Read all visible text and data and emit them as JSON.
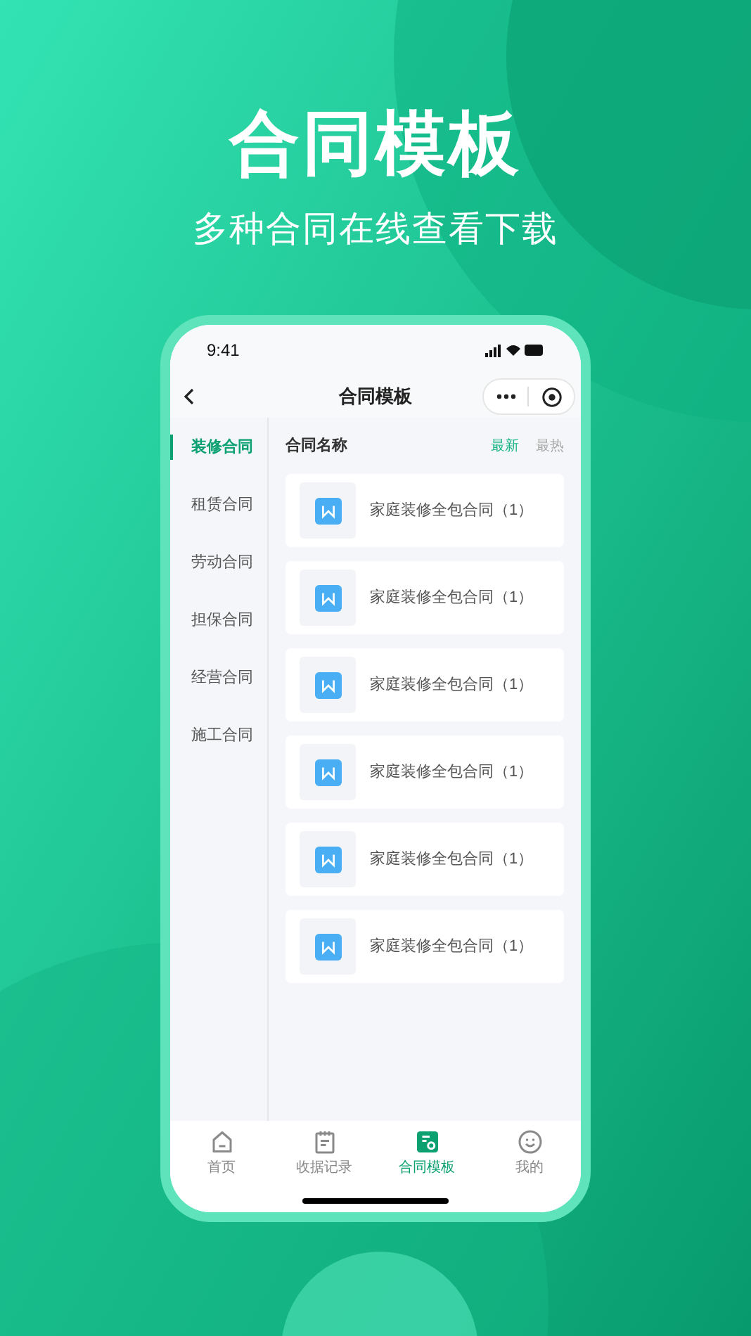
{
  "headline": "合同模板",
  "subheadline": "多种合同在线查看下载",
  "status_bar": {
    "time": "9:41"
  },
  "nav": {
    "title": "合同模板"
  },
  "categories": [
    {
      "label": "装修合同",
      "selected": true
    },
    {
      "label": "租赁合同",
      "selected": false
    },
    {
      "label": "劳动合同",
      "selected": false
    },
    {
      "label": "担保合同",
      "selected": false
    },
    {
      "label": "经营合同",
      "selected": false
    },
    {
      "label": "施工合同",
      "selected": false
    }
  ],
  "list_header": {
    "title": "合同名称",
    "sorts": [
      {
        "label": "最新",
        "selected": true
      },
      {
        "label": "最热",
        "selected": false
      }
    ]
  },
  "contracts": [
    {
      "name": "家庭装修全包合同（1）"
    },
    {
      "name": "家庭装修全包合同（1）"
    },
    {
      "name": "家庭装修全包合同（1）"
    },
    {
      "name": "家庭装修全包合同（1）"
    },
    {
      "name": "家庭装修全包合同（1）"
    },
    {
      "name": "家庭装修全包合同（1）"
    }
  ],
  "tab_bar": [
    {
      "label": "首页",
      "kind": "home",
      "selected": false
    },
    {
      "label": "收据记录",
      "kind": "notes",
      "selected": false
    },
    {
      "label": "合同模板",
      "kind": "template",
      "selected": true
    },
    {
      "label": "我的",
      "kind": "profile",
      "selected": false
    }
  ]
}
